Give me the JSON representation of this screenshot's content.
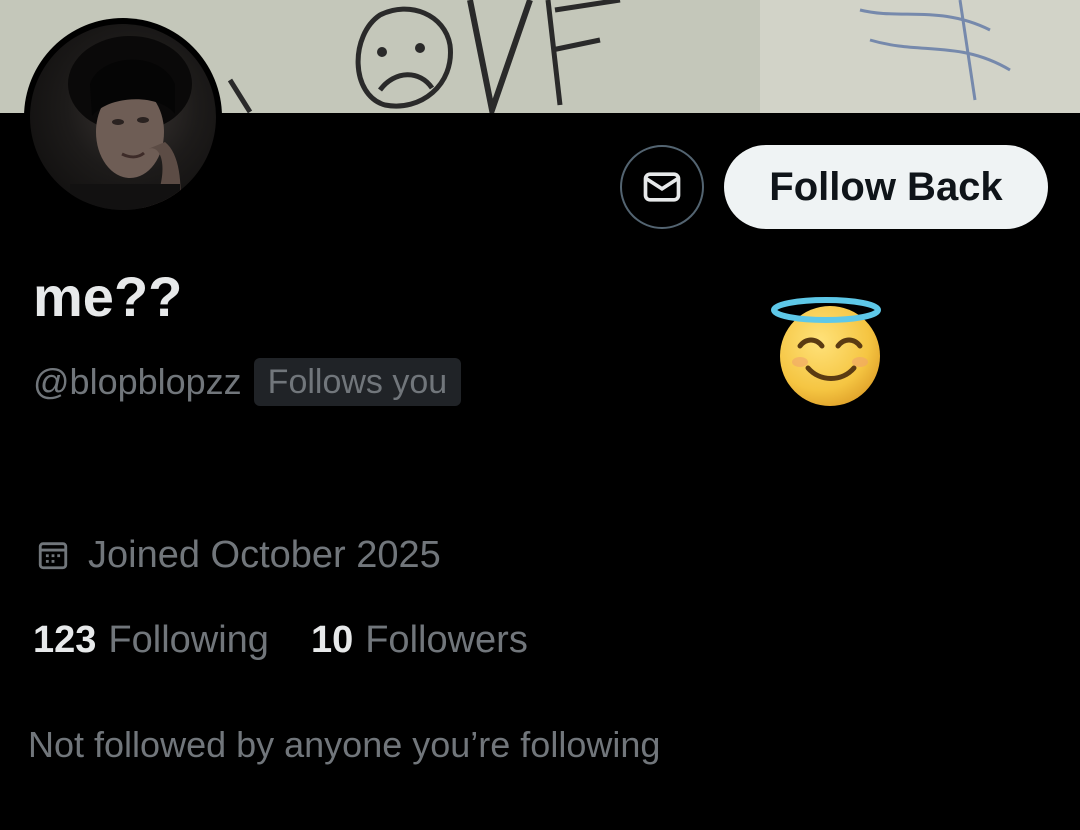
{
  "profile": {
    "display_name": "me??",
    "handle": "@blopblopzz",
    "follows_you_badge": "Follows you",
    "bio_emoji": "😇",
    "joined": "Joined October 2025",
    "stats": {
      "following_count": "123",
      "following_label": "Following",
      "followers_count": "10",
      "followers_label": "Followers"
    },
    "mutuals_text": "Not followed by anyone you’re following"
  },
  "actions": {
    "follow_back_label": "Follow Back",
    "message_icon": "envelope-icon"
  },
  "icons": {
    "joined": "calendar-icon"
  },
  "colors": {
    "background": "#000000",
    "primary_text": "#e7e9ea",
    "secondary_text": "#71767b",
    "follow_button_bg": "#eff3f4",
    "follow_button_text": "#0f1419",
    "border": "#536471",
    "badge_bg": "#202327"
  }
}
